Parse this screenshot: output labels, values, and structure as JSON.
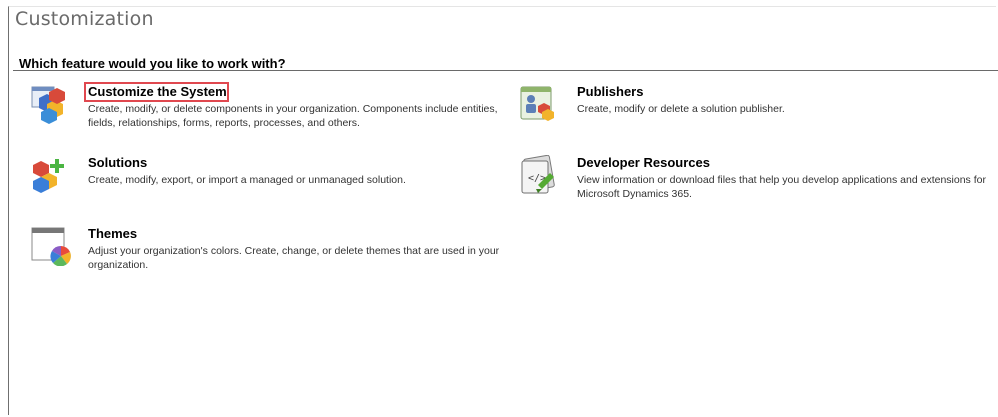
{
  "page": {
    "title": "Customization",
    "question": "Which feature would you like to work with?"
  },
  "features": [
    {
      "title": "Customize the System",
      "description": "Create, modify, or delete components in your organization. Components include entities, fields, relationships, forms, reports, processes, and others.",
      "icon": "customize-cubes-icon",
      "selected": true
    },
    {
      "title": "Publishers",
      "description": "Create, modify or delete a solution publisher.",
      "icon": "publisher-icon",
      "selected": false
    },
    {
      "title": "Solutions",
      "description": "Create, modify, export, or import a managed or unmanaged solution.",
      "icon": "solution-cubes-icon",
      "selected": false
    },
    {
      "title": "Developer Resources",
      "description": "View information or download files that help you develop applications and extensions for Microsoft Dynamics 365.",
      "icon": "developer-resources-icon",
      "selected": false
    },
    {
      "title": "Themes",
      "description": "Adjust your organization's colors. Create, change, or delete themes that are used in your organization.",
      "icon": "themes-icon",
      "selected": false
    }
  ],
  "colors": {
    "highlight_border": "#e0484f",
    "title_text": "#6a6a6a"
  }
}
